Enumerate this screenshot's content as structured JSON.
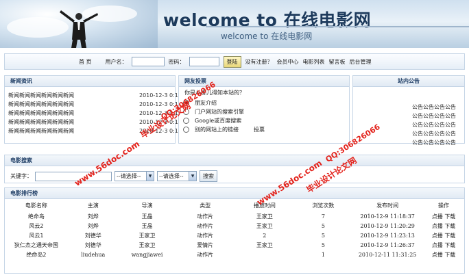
{
  "banner": {
    "title": "welcome to 在线电影网",
    "subtitle": "welcome to 在线电影网"
  },
  "navbar": {
    "home": "首 页",
    "username_label": "用户名：",
    "password_label": "密码：",
    "login_button": "登陆",
    "register_link": "没有注册？",
    "member_center": "会员中心",
    "movie_list": "电影列表",
    "message_board": "留言板",
    "admin": "后台管理"
  },
  "news": {
    "header": "新闻资讯",
    "items": [
      {
        "text": "新闻新闻新闻新闻新闻新闻",
        "date": "2010-12-3 0:18"
      },
      {
        "text": "新闻新闻新闻新闻新闻新闻",
        "date": "2010-12-3 0:18:20"
      },
      {
        "text": "新闻新闻新闻新闻新闻新闻",
        "date": "2010-12-3 0:18:23"
      },
      {
        "text": "新闻新闻新闻新闻新闻新闻",
        "date": "2010-12-3 0:18:26"
      },
      {
        "text": "新闻新闻新闻新闻新闻新闻",
        "date": "2010-12-3 0:18:29"
      }
    ]
  },
  "poll": {
    "header": "网友投票",
    "question": "你是从哪儿得知本站的？",
    "options": [
      "朋友介绍",
      "门户网站的搜索引擎",
      "Google或百度搜索",
      "别的网站上的链接"
    ],
    "vote_link": "投票"
  },
  "notice": {
    "header": "站内公告",
    "items": [
      "公告公告公告公告",
      "公告公告公告公告",
      "公告公告公告公告",
      "公告公告公告公告",
      "公告公告公告公告"
    ]
  },
  "search": {
    "header": "电影搜索",
    "keyword_label": "关键字：",
    "select1": "--请选择--",
    "select2": "--请选择--",
    "button": "搜索"
  },
  "ranking": {
    "header": "电影排行榜",
    "columns": [
      "电影名称",
      "主演",
      "导演",
      "类型",
      "播放时间",
      "浏览次数",
      "发布时间",
      "操作"
    ],
    "rows": [
      [
        "绝命岛",
        "刘烨",
        "王晶",
        "动作片",
        "王家卫",
        "7",
        "2010-12-9 11:18:37"
      ],
      [
        "风云2",
        "刘烨",
        "王晶",
        "动作片",
        "王家卫",
        "5",
        "2010-12-9 11:20:29"
      ],
      [
        "风云1",
        "刘德华",
        "王家卫",
        "动作片",
        "2",
        "5",
        "2010-12-9 11:23:13"
      ],
      [
        "狄仁杰之通天帝国",
        "刘德华",
        "王家卫",
        "爱情片",
        "王家卫",
        "5",
        "2010-12-9 11:26:37"
      ],
      [
        "绝命岛2",
        "liudehua",
        "wangjiawei",
        "动作片",
        "",
        "1",
        "2010-12-11 11:31:25"
      ]
    ],
    "action_play": "点播",
    "action_download": "下载"
  },
  "watermarks": {
    "site": "www.56doc.com",
    "qq": "QQ:306826066",
    "brand": "毕业设计论文网"
  }
}
